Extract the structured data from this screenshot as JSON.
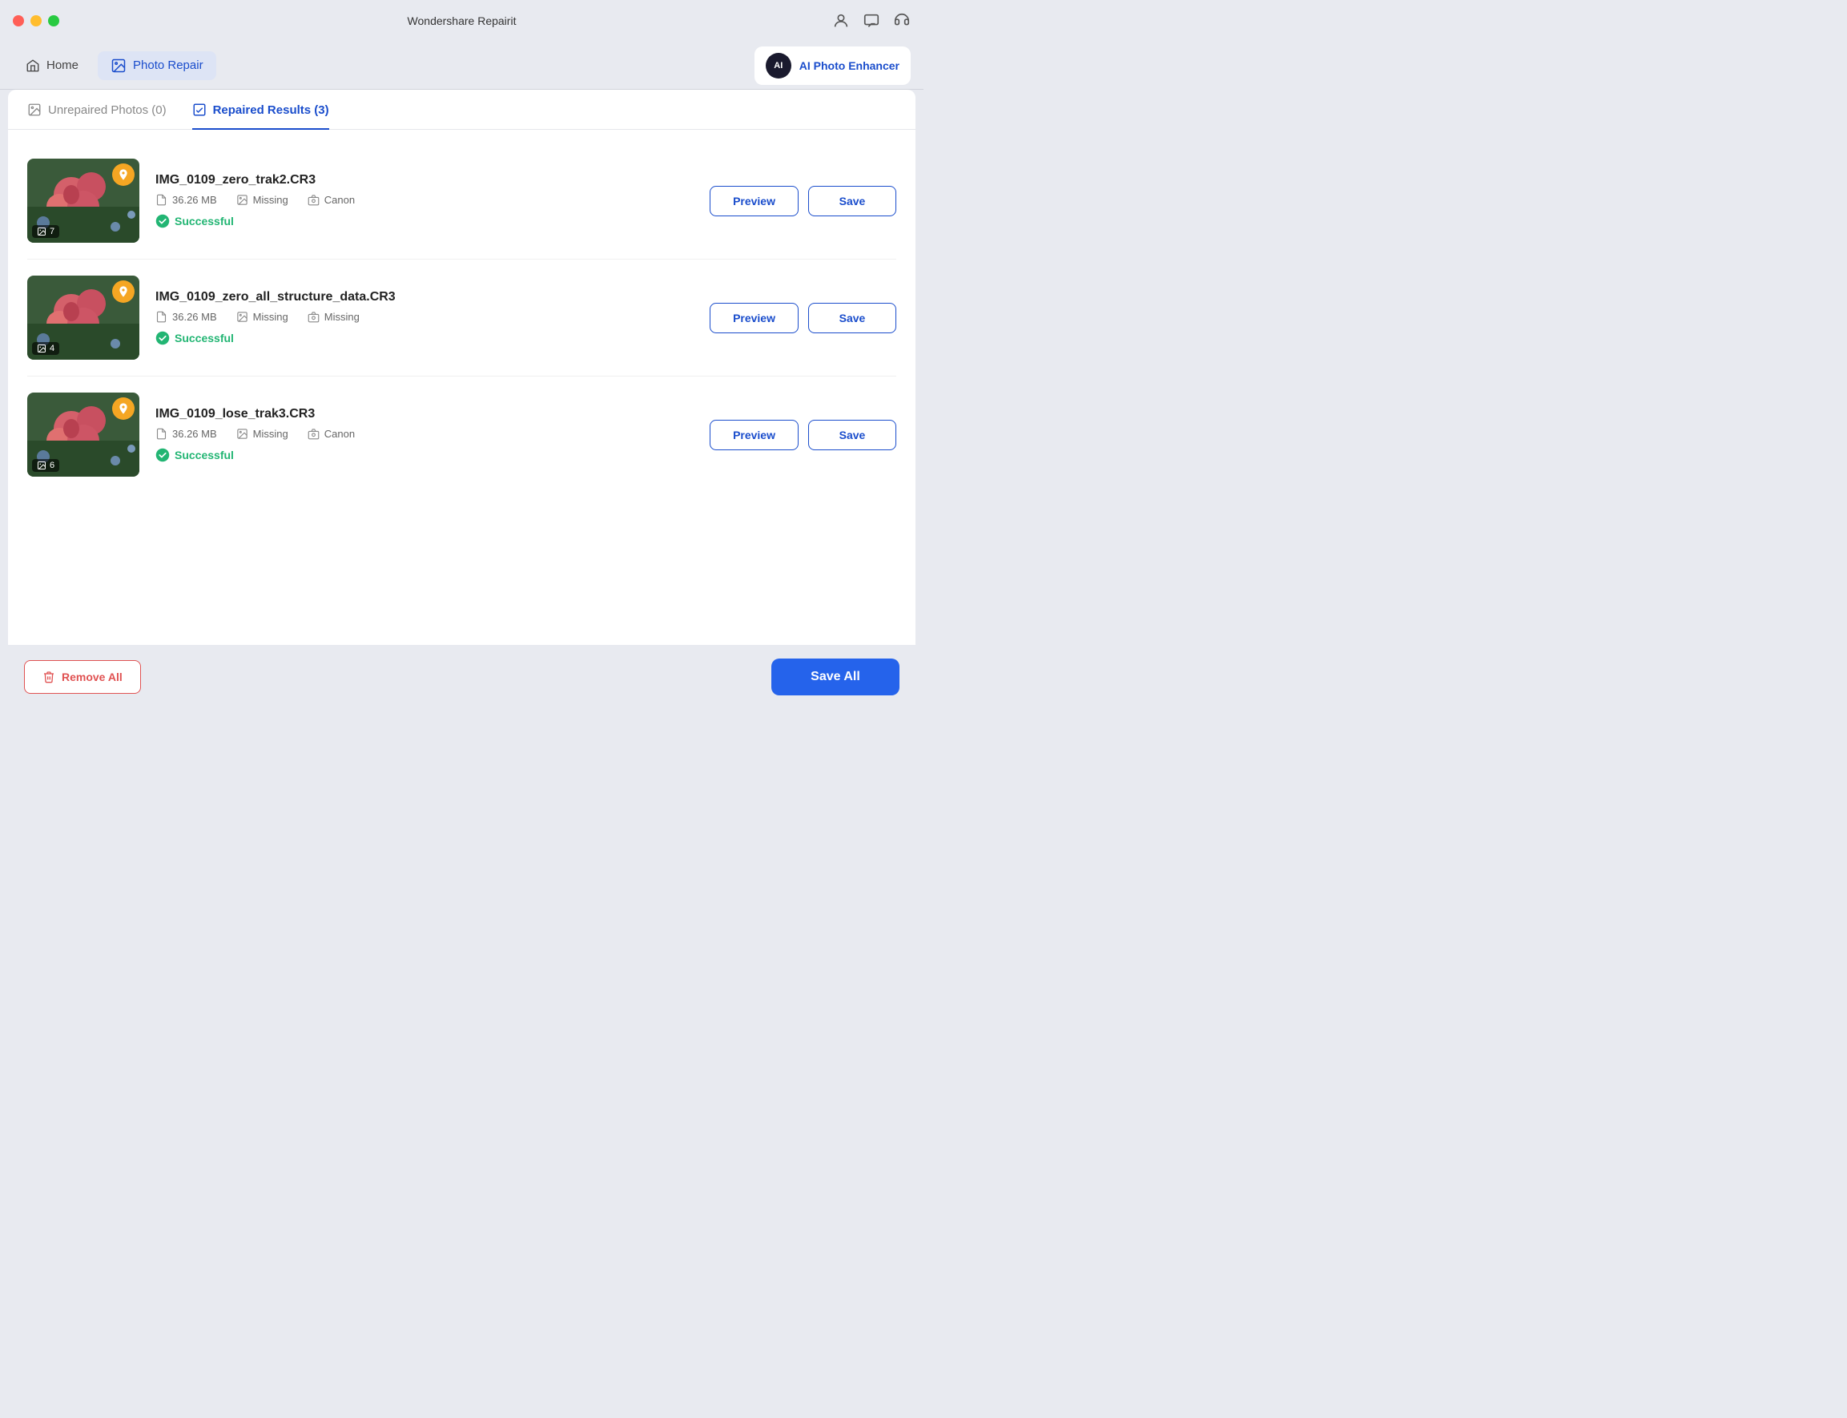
{
  "window": {
    "title": "Wondershare Repairit"
  },
  "navbar": {
    "home_label": "Home",
    "photo_repair_label": "Photo Repair",
    "ai_enhancer_label": "AI Photo Enhancer",
    "ai_icon_text": "AI"
  },
  "tabs": {
    "unrepaired": "Unrepaired Photos (0)",
    "repaired": "Repaired Results (3)"
  },
  "photos": [
    {
      "name": "IMG_0109_zero_trak2.CR3",
      "size": "36.26 MB",
      "issue1": "Missing",
      "issue2": "Canon",
      "status": "Successful",
      "thumb_count": "7"
    },
    {
      "name": "IMG_0109_zero_all_structure_data.CR3",
      "size": "36.26 MB",
      "issue1": "Missing",
      "issue2": "Missing",
      "status": "Successful",
      "thumb_count": "4"
    },
    {
      "name": "IMG_0109_lose_trak3.CR3",
      "size": "36.26 MB",
      "issue1": "Missing",
      "issue2": "Canon",
      "status": "Successful",
      "thumb_count": "6"
    }
  ],
  "buttons": {
    "preview": "Preview",
    "save": "Save",
    "remove_all": "Remove All",
    "save_all": "Save All"
  }
}
